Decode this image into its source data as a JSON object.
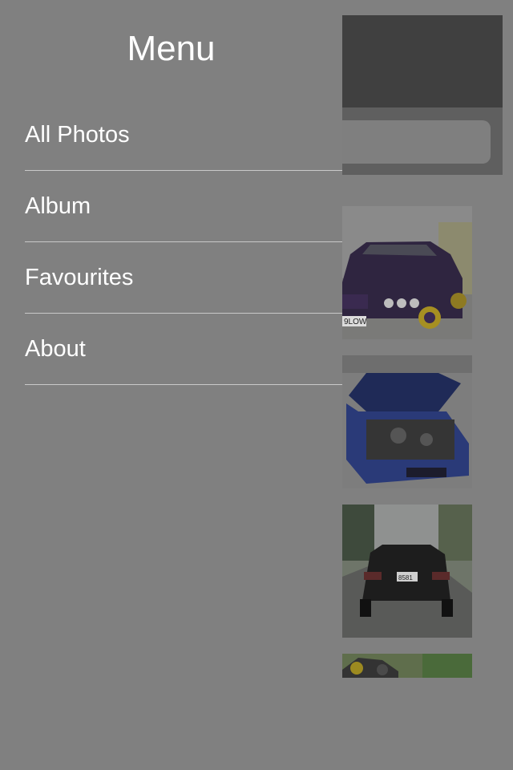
{
  "menu": {
    "title": "Menu",
    "items": [
      {
        "label": "All Photos"
      },
      {
        "label": "Album"
      },
      {
        "label": "Favourites"
      },
      {
        "label": "About"
      }
    ]
  },
  "background_app": {
    "photos": [
      {
        "name": "purple-car-photo",
        "plate_text": "9LOW"
      },
      {
        "name": "blue-car-engine-photo"
      },
      {
        "name": "black-car-rear-photo",
        "plate_text": "8581"
      },
      {
        "name": "yellow-car-photo"
      }
    ]
  },
  "colors": {
    "overlay": "#808080",
    "menu_text": "#ffffff",
    "divider": "#c9c9c9",
    "navbar": "#404040"
  }
}
